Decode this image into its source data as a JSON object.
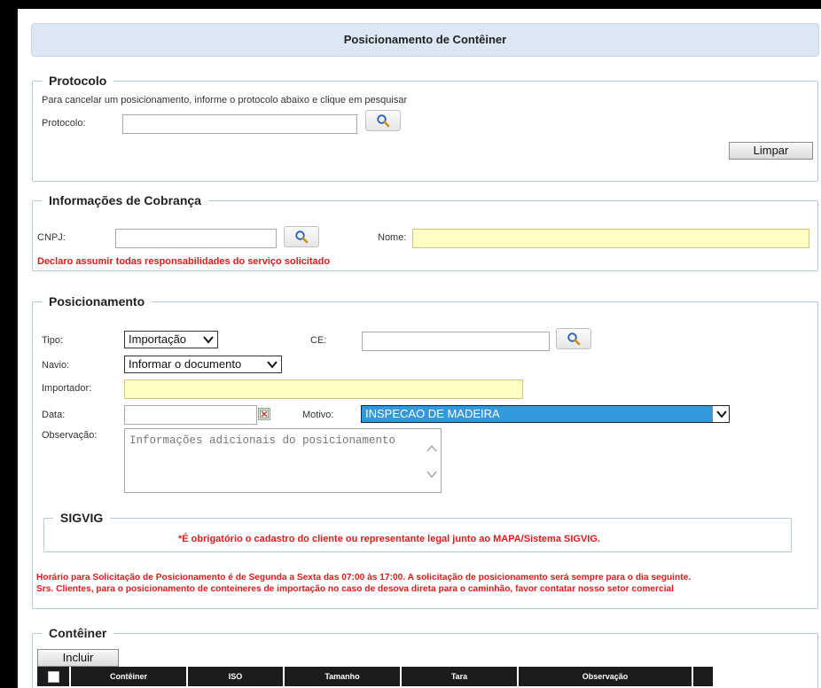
{
  "title": "Posicionamento de Contêiner",
  "protocolo": {
    "legend": "Protocolo",
    "instruction": "Para cancelar um posicionamento, informe o protocolo abaixo e clique em pesquisar",
    "label": "Protocolo:",
    "value": "",
    "clear_label": "Limpar"
  },
  "cobranca": {
    "legend": "Informações de Cobrança",
    "cnpj_label": "CNPJ:",
    "cnpj_value": "",
    "nome_label": "Nome:",
    "nome_value": "",
    "declaration": "Declaro assumir todas responsabilidades do serviço solicitado"
  },
  "posicionamento": {
    "legend": "Posicionamento",
    "tipo_label": "Tipo:",
    "tipo_value": "Importação",
    "ce_label": "CE:",
    "ce_value": "",
    "navio_label": "Navio:",
    "navio_value": "Informar o documento",
    "importador_label": "Importador:",
    "importador_value": "",
    "data_label": "Data:",
    "data_value": "",
    "motivo_label": "Motivo:",
    "motivo_value": "INSPECAO DE MADEIRA",
    "observacao_label": "Observação:",
    "observacao_placeholder": "Informações adicionais do posicionamento",
    "sigvig": {
      "legend": "SIGVIG",
      "notice": "*É obrigatório o cadastro do cliente ou representante legal junto ao MAPA/Sistema SIGVIG."
    },
    "schedule_notice": "Horário para Solicitação de Posicionamento é de Segunda a Sexta das 07:00 às 17:00. A solicitação de posicionamento será sempre para o dia seguinte.",
    "contact_notice": "Srs. Clientes, para o posicionamento de conteineres de importação no caso de desova direta para o caminhão, favor contatar nosso setor comercial"
  },
  "conteiner": {
    "legend": "Contêiner",
    "add_label": "Incluir",
    "columns": [
      "Contêiner",
      "ISO",
      "Tamanho",
      "Tara",
      "Observação"
    ]
  },
  "colors": {
    "header_bg": "#dde7f3",
    "required_field": "#ffffc4",
    "alert_text": "#e31a1a",
    "selected_option": "#3399dd",
    "table_header": "#1c1c1c"
  }
}
